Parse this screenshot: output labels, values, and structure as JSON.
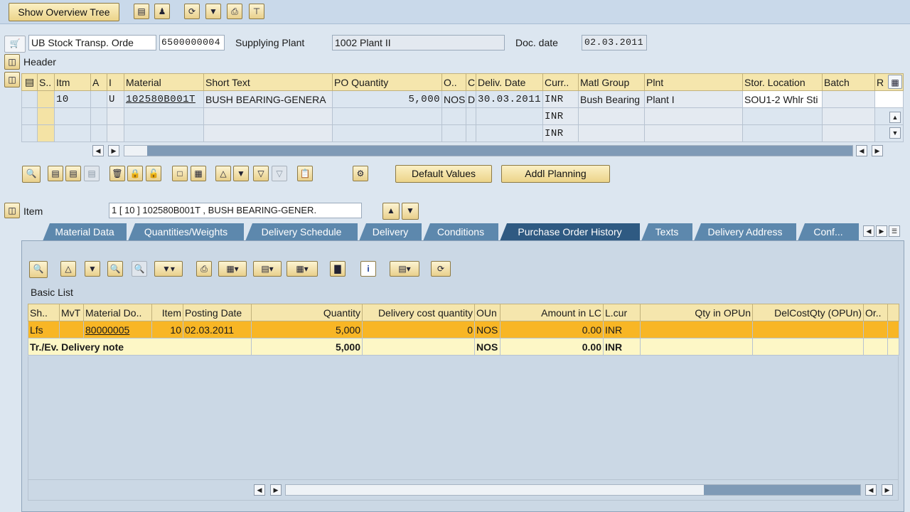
{
  "toolbar": {
    "overview_button": "Show Overview Tree",
    "icons": [
      "document-icon",
      "person-icon",
      "refresh-icon",
      "filter-icon",
      "print-icon",
      "layout-icon"
    ]
  },
  "header_fields": {
    "doc_type": "UB Stock Transp. Orde",
    "doc_number": "6500000004",
    "supplying_plant_label": "Supplying Plant",
    "supplying_plant_value": "1002 Plant II",
    "doc_date_label": "Doc. date",
    "doc_date_value": "02.03.2011"
  },
  "header_section": {
    "label": "Header"
  },
  "items_table": {
    "columns": [
      "S..",
      "Itm",
      "A",
      "I",
      "Material",
      "Short Text",
      "PO Quantity",
      "O..",
      "C",
      "Deliv. Date",
      "Curr..",
      "Matl Group",
      "Plnt",
      "Stor. Location",
      "Batch",
      "R"
    ],
    "rows": [
      {
        "itm": "10",
        "a": "",
        "i": "U",
        "material": "102580B001T",
        "short_text": "BUSH BEARING-GENERA",
        "po_qty": "5,000",
        "o": "NOS",
        "c": "D",
        "deliv_date": "30.03.2011",
        "curr": "INR",
        "matl_group": "Bush Bearing",
        "plnt": "Plant I",
        "stor_loc": "SOU1-2 Whlr Sti",
        "batch": ""
      },
      {
        "itm": "",
        "a": "",
        "i": "",
        "material": "",
        "short_text": "",
        "po_qty": "",
        "o": "",
        "c": "",
        "deliv_date": "",
        "curr": "INR",
        "matl_group": "",
        "plnt": "",
        "stor_loc": "",
        "batch": ""
      },
      {
        "itm": "",
        "a": "",
        "i": "",
        "material": "",
        "short_text": "",
        "po_qty": "",
        "o": "",
        "c": "",
        "deliv_date": "",
        "curr": "INR",
        "matl_group": "",
        "plnt": "",
        "stor_loc": "",
        "batch": ""
      }
    ]
  },
  "item_buttons": {
    "default_values": "Default Values",
    "addl_planning": "Addl Planning"
  },
  "item_section": {
    "label": "Item",
    "selected": "1 [ 10 ] 102580B001T , BUSH BEARING-GENER."
  },
  "tabs": [
    {
      "label": "Material Data",
      "active": false
    },
    {
      "label": "Quantities/Weights",
      "active": false
    },
    {
      "label": "Delivery Schedule",
      "active": false
    },
    {
      "label": "Delivery",
      "active": false
    },
    {
      "label": "Conditions",
      "active": false
    },
    {
      "label": "Purchase Order History",
      "active": true
    },
    {
      "label": "Texts",
      "active": false
    },
    {
      "label": "Delivery Address",
      "active": false
    },
    {
      "label": "Conf...",
      "active": false
    }
  ],
  "history": {
    "list_title": "Basic List",
    "columns": [
      "Sh..",
      "MvT",
      "Material Do..",
      "Item",
      "Posting Date",
      "Quantity",
      "Delivery cost quantity",
      "OUn",
      "Amount in LC",
      "L.cur",
      "Qty in OPUn",
      "DelCostQty (OPUn)",
      "Or.."
    ],
    "row": {
      "sh": "Lfs",
      "mvt": "",
      "mat_doc": "80000005",
      "item": "10",
      "posting_date": "02.03.2011",
      "quantity": "5,000",
      "del_cost_qty": "0",
      "oun": "NOS",
      "amount_lc": "0.00",
      "lcur": "INR",
      "qty_opun": "",
      "delcost_opun": "",
      "or": ""
    },
    "total": {
      "label": "Tr./Ev. Delivery note",
      "quantity": "5,000",
      "oun": "NOS",
      "amount_lc": "0.00",
      "lcur": "INR"
    }
  },
  "colors": {
    "toolbar_bg": "#c9d9ea",
    "tab": "#5d88ad",
    "tab_active": "#2f5a82",
    "header_row": "#f5e6ad",
    "highlight_row": "#f8b625",
    "total_row": "#fdf7c6"
  }
}
